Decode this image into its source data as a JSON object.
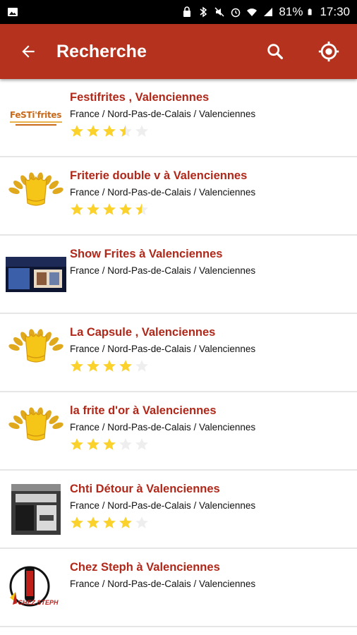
{
  "status_bar": {
    "battery": "81%",
    "time": "17:30"
  },
  "app_bar": {
    "title": "Recherche",
    "back_icon": "arrow-left-icon",
    "search_icon": "search-icon",
    "location_icon": "gps-target-icon",
    "color": "#b5331e"
  },
  "colors": {
    "title": "#b0281a",
    "star_on": "#fbd12b",
    "star_off": "#eeeeee"
  },
  "results": [
    {
      "name": "Festifrites , Valenciennes",
      "location": "France / Nord-Pas-de-Calais / Valenciennes",
      "rating": 3.5,
      "logo": "festifrites-logo",
      "logo_text": "FeSTi'frites"
    },
    {
      "name": "Friterie double v à Valenciennes",
      "location": "France / Nord-Pas-de-Calais / Valenciennes",
      "rating": 4.5,
      "logo": "gold-fries-laurel-icon"
    },
    {
      "name": "Show Frites à Valenciennes",
      "location": "France / Nord-Pas-de-Calais / Valenciennes",
      "rating": null,
      "logo": "storefront-photo"
    },
    {
      "name": "La Capsule , Valenciennes",
      "location": "France / Nord-Pas-de-Calais / Valenciennes",
      "rating": 4,
      "logo": "gold-fries-laurel-icon"
    },
    {
      "name": "la frite d'or à Valenciennes",
      "location": "France / Nord-Pas-de-Calais / Valenciennes",
      "rating": 3,
      "logo": "gold-fries-laurel-icon"
    },
    {
      "name": "Chti Détour à Valenciennes",
      "location": "France / Nord-Pas-de-Calais / Valenciennes",
      "rating": 4,
      "logo": "storefront-photo"
    },
    {
      "name": "Chez Steph à Valenciennes",
      "location": "France / Nord-Pas-de-Calais / Valenciennes",
      "rating": null,
      "logo": "chez-steph-logo",
      "logo_text": "CHEZ STEPH"
    }
  ]
}
